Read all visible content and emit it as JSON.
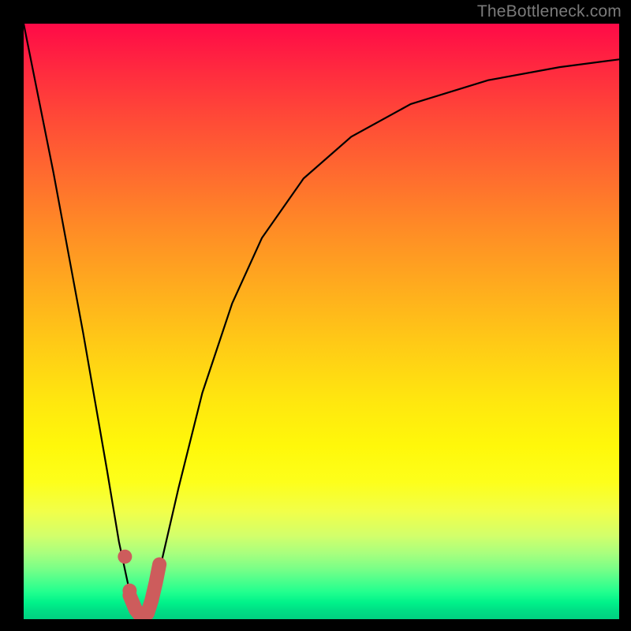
{
  "attribution": "TheBottleneck.com",
  "chart_data": {
    "type": "line",
    "title": "",
    "xlabel": "",
    "ylabel": "",
    "xlim": [
      0,
      100
    ],
    "ylim": [
      0,
      100
    ],
    "series": [
      {
        "name": "bottleneck-curve",
        "x": [
          0,
          5,
          10,
          14,
          16,
          17.5,
          19,
          20,
          21,
          23,
          26,
          30,
          35,
          40,
          47,
          55,
          65,
          78,
          90,
          100
        ],
        "values": [
          100,
          75,
          48,
          25,
          13,
          6,
          2,
          0.5,
          2,
          9,
          22,
          38,
          53,
          64,
          74,
          81,
          86.5,
          90.5,
          92.7,
          94
        ]
      }
    ],
    "markers": [
      {
        "label": "point-a",
        "x": 17.0,
        "y": 10.5
      },
      {
        "label": "point-b",
        "x": 17.8,
        "y": 4.8
      }
    ],
    "highlight_segment": {
      "x": [
        17.8,
        18.8,
        19.6,
        20.2,
        20.8,
        21.5,
        22.2,
        22.8
      ],
      "values": [
        4.0,
        1.6,
        0.6,
        0.4,
        1.0,
        3.2,
        6.2,
        9.2
      ]
    },
    "gradient_stops": [
      {
        "pos": 0,
        "color": "#ff0a47"
      },
      {
        "pos": 0.45,
        "color": "#ffb81a"
      },
      {
        "pos": 0.72,
        "color": "#fff80a"
      },
      {
        "pos": 0.9,
        "color": "#8cff82"
      },
      {
        "pos": 1.0,
        "color": "#00d181"
      }
    ]
  }
}
